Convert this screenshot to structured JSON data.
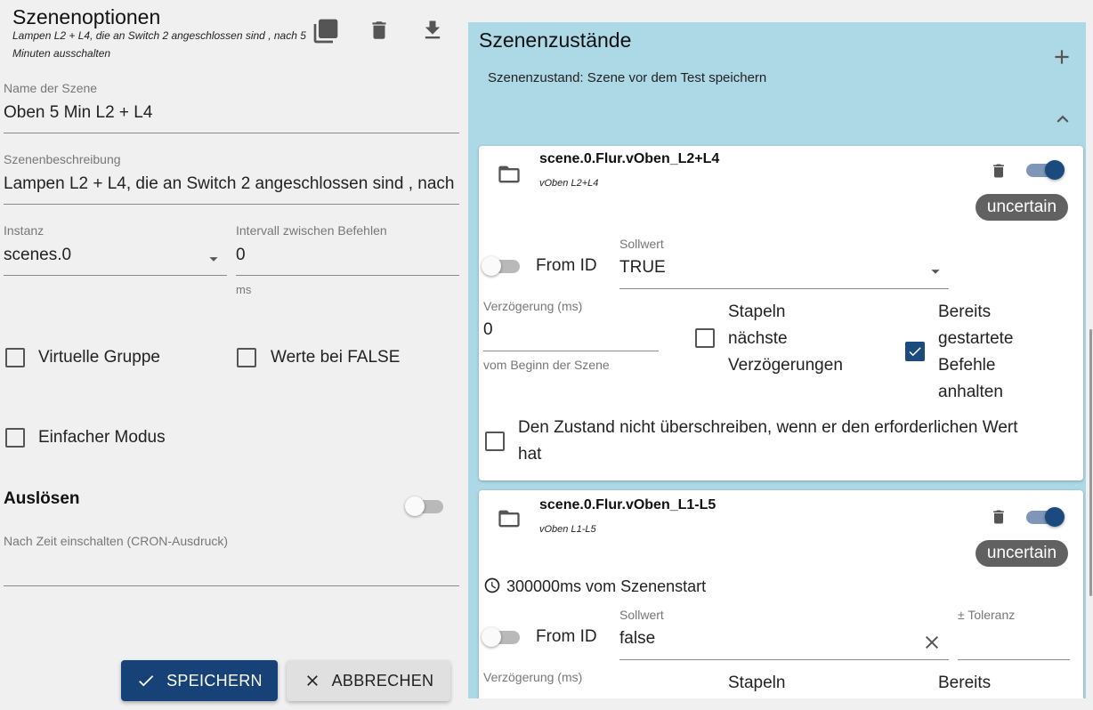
{
  "left": {
    "title": "Szenenoptionen",
    "subtitle": "Lampen L2 + L4, die an Switch 2 angeschlossen sind , nach 5 Minuten ausschalten",
    "name_label": "Name der Szene",
    "name_value": "Oben 5 Min L2 + L4",
    "desc_label": "Szenenbeschreibung",
    "desc_value": "Lampen L2 + L4, die an Switch 2 angeschlossen sind , nach 5 Minuten ausschalten",
    "instance_label": "Instanz",
    "instance_value": "scenes.0",
    "interval_label": "Intervall zwischen Befehlen",
    "interval_value": "0",
    "interval_unit": "ms",
    "virtual_group": "Virtuelle Gruppe",
    "values_false": "Werte bei FALSE",
    "easy_mode": "Einfacher Modus",
    "trigger_title": "Auslösen",
    "cron_label": "Nach Zeit einschalten (CRON-Ausdruck)",
    "cron_value": "",
    "save": "SPEICHERN",
    "cancel": "ABBRECHEN"
  },
  "right": {
    "title": "Szenenzustände",
    "state_label": "Szenenzustand: Szene vor dem Test speichern",
    "cards": [
      {
        "id": "scene.0.Flur.vOben_L2+L4",
        "name": "vOben L2+L4",
        "status": "uncertain",
        "from_id": "From ID",
        "setpoint_label": "Sollwert",
        "setpoint_value": "TRUE",
        "delay_label": "Verzögerung (ms)",
        "delay_value": "0",
        "delay_helper": "vom Beginn der Szene",
        "stack_l1": "Stapeln",
        "stack_l2": "nächste",
        "stack_l3": "Verzögerungen",
        "stop_l1": "Bereits",
        "stop_l2": "gestartete",
        "stop_l3": "Befehle",
        "stop_l4": "anhalten",
        "no_overwrite_l1": "Den Zustand nicht überschreiben, wenn er den erforderlichen Wert",
        "no_overwrite_l2": "hat"
      },
      {
        "id": "scene.0.Flur.vOben_L1-L5",
        "name": "vOben L1-L5",
        "status": "uncertain",
        "timing": "300000ms vom Szenenstart",
        "from_id": "From ID",
        "setpoint_label": "Sollwert",
        "setpoint_value": "false",
        "tolerance_label": "± Toleranz",
        "tolerance_value": "",
        "delay_label": "Verzögerung (ms)",
        "stack_l1": "Stapeln",
        "stop_l1": "Bereits"
      }
    ]
  },
  "colors": {
    "primary": "#164278",
    "panel_bg": "#add8e6",
    "switch_on": "#1a4a7e",
    "chip": "#616161"
  },
  "icons": [
    "copy-icon",
    "delete-icon",
    "download-icon",
    "add-icon",
    "chevron-up-icon",
    "folder-open-icon",
    "delete-icon",
    "clock-icon",
    "clear-icon",
    "dropdown-arrow-icon",
    "check-icon",
    "close-icon"
  ]
}
